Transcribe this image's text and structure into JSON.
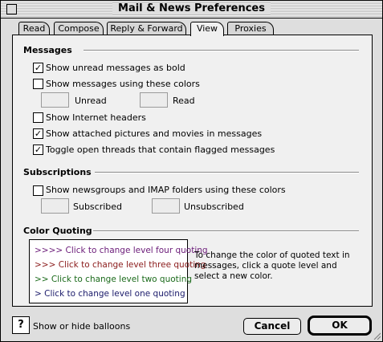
{
  "window": {
    "title": "Mail & News Preferences"
  },
  "tabs": [
    {
      "label": "Read",
      "active": false
    },
    {
      "label": "Compose",
      "active": false
    },
    {
      "label": "Reply & Forward",
      "active": false
    },
    {
      "label": "View",
      "active": true
    },
    {
      "label": "Proxies",
      "active": false
    }
  ],
  "messages": {
    "title": "Messages",
    "show_bold": {
      "label": "Show unread messages as bold",
      "checked": true
    },
    "use_colors": {
      "label": "Show messages using these colors",
      "checked": false
    },
    "unread_label": "Unread",
    "read_label": "Read",
    "internet_headers": {
      "label": "Show Internet headers",
      "checked": false
    },
    "attached": {
      "label": "Show attached pictures and movies in messages",
      "checked": true
    },
    "toggle_threads": {
      "label": "Toggle open threads that contain flagged messages",
      "checked": true
    }
  },
  "subscriptions": {
    "title": "Subscriptions",
    "use_colors": {
      "label": "Show newsgroups and IMAP folders using these colors",
      "checked": false
    },
    "subscribed_label": "Subscribed",
    "unsubscribed_label": "Unsubscribed"
  },
  "color_quoting": {
    "title": "Color Quoting",
    "levels": [
      {
        "label": ">>>> Click to change level four quoting",
        "color": "#6a1a78"
      },
      {
        "label": ">>> Click to change level three quoting",
        "color": "#8a1a1a"
      },
      {
        "label": ">> Click to change level two quoting",
        "color": "#1a6a1a"
      },
      {
        "label": "> Click to change level one quoting",
        "color": "#1a1a6a"
      }
    ],
    "help_text": "To change the color of quoted text in messages, click a quote level and select a new color."
  },
  "footer": {
    "balloons_label": "Show or hide balloons",
    "cancel_label": "Cancel",
    "ok_label": "OK",
    "help_glyph": "?"
  }
}
